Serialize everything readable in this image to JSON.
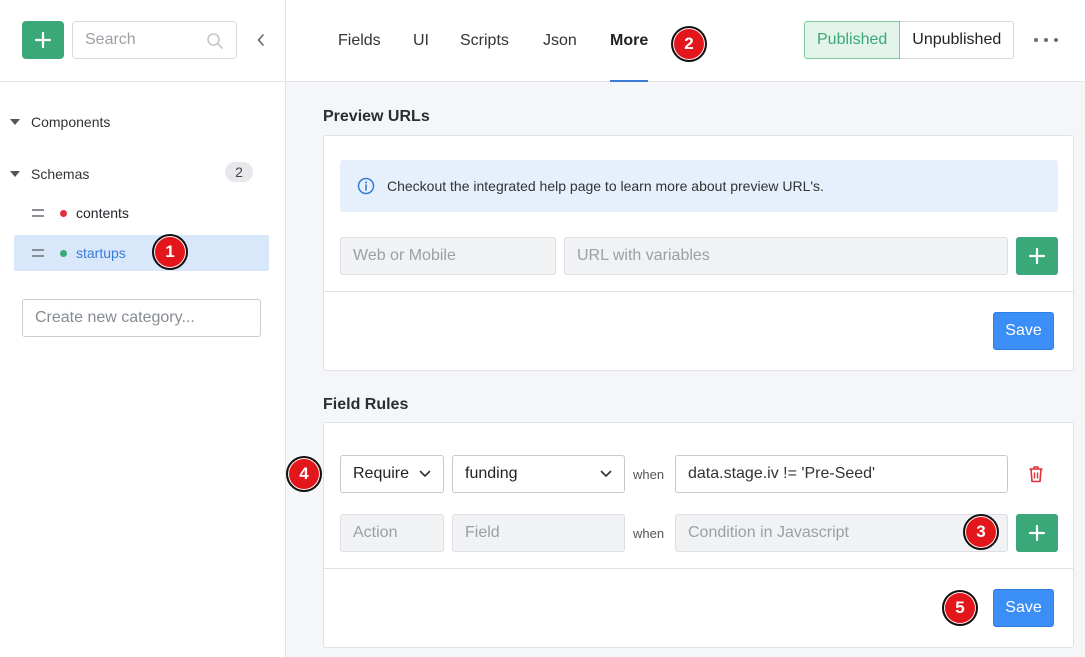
{
  "sidebar": {
    "search_placeholder": "Search",
    "groups": {
      "components_label": "Components",
      "schemas_label": "Schemas",
      "schemas_count": "2"
    },
    "schemas": [
      {
        "label": "contents",
        "dot_color": "#e0303a"
      },
      {
        "label": "startups",
        "dot_color": "#3aa878"
      }
    ],
    "create_category_placeholder": "Create new category..."
  },
  "tabs": [
    "Fields",
    "UI",
    "Scripts",
    "Json",
    "More"
  ],
  "active_tab": "More",
  "publish": {
    "published_label": "Published",
    "unpublished_label": "Unpublished",
    "active": "Published"
  },
  "preview": {
    "title": "Preview URLs",
    "info_text": "Checkout the integrated help page to learn more about preview URL's.",
    "name_placeholder": "Web or Mobile",
    "url_placeholder": "URL with variables",
    "save_label": "Save"
  },
  "rules": {
    "title": "Field Rules",
    "rule": {
      "action": "Require",
      "field": "funding",
      "when_label": "when",
      "condition": "data.stage.iv != 'Pre-Seed'"
    },
    "new_rule": {
      "action_placeholder": "Action",
      "field_placeholder": "Field",
      "when_label": "when",
      "condition_placeholder": "Condition in Javascript"
    },
    "save_label": "Save"
  },
  "markers": [
    "1",
    "2",
    "3",
    "4",
    "5"
  ],
  "colors": {
    "accent_green": "#3aa878",
    "accent_blue": "#3a8ef6",
    "marker_red": "#e3161b",
    "danger": "#e0303a"
  }
}
